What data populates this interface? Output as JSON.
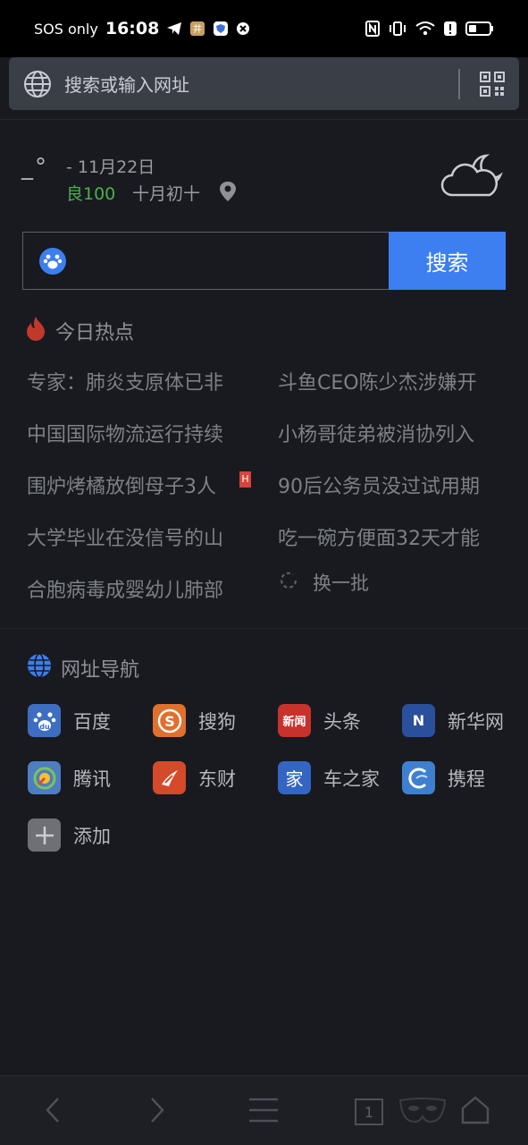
{
  "status_bar": {
    "carrier": "SOS only",
    "time": "16:08"
  },
  "address_bar": {
    "placeholder": "搜索或输入网址"
  },
  "weather": {
    "temperature": "_°",
    "date": "-  11月22日",
    "aqi": "良100",
    "lunar_date": "十月初十"
  },
  "search": {
    "button_label": "搜索"
  },
  "hot_news": {
    "title": "今日热点",
    "items": [
      "专家：肺炎支原体已非",
      "斗鱼CEO陈少杰涉嫌开",
      "中国国际物流运行持续",
      "小杨哥徒弟被消协列入",
      "围炉烤橘放倒母子3人",
      "90后公务员没过试用期",
      "大学毕业在没信号的山",
      "吃一碗方便面32天才能",
      "合胞病毒成婴幼儿肺部"
    ],
    "hot_badge": "H",
    "refresh_label": "换一批"
  },
  "nav": {
    "title": "网址导航",
    "sites": [
      {
        "label": "百度",
        "icon": "baidu-icon",
        "color": "#3e6ec2",
        "glyph": "du"
      },
      {
        "label": "搜狗",
        "icon": "sogou-icon",
        "color": "#e0702e",
        "glyph": "S"
      },
      {
        "label": "头条",
        "icon": "toutiao-icon",
        "color": "#c8322c",
        "glyph": "新闻"
      },
      {
        "label": "新华网",
        "icon": "xinhua-icon",
        "color": "#2a4f9c",
        "glyph": "N"
      },
      {
        "label": "腾讯",
        "icon": "tencent-icon",
        "color": "#4f7dc2",
        "glyph": "◎"
      },
      {
        "label": "东财",
        "icon": "eastmoney-icon",
        "color": "#d44a2a",
        "glyph": "✓"
      },
      {
        "label": "车之家",
        "icon": "autohome-icon",
        "color": "#3565c4",
        "glyph": "家"
      },
      {
        "label": "携程",
        "icon": "ctrip-icon",
        "color": "#3f7fd0",
        "glyph": "C"
      },
      {
        "label": "添加",
        "icon": "add-icon",
        "color": "#6e7076",
        "glyph": "+"
      }
    ]
  },
  "toolbar": {
    "tab_count": "1"
  }
}
